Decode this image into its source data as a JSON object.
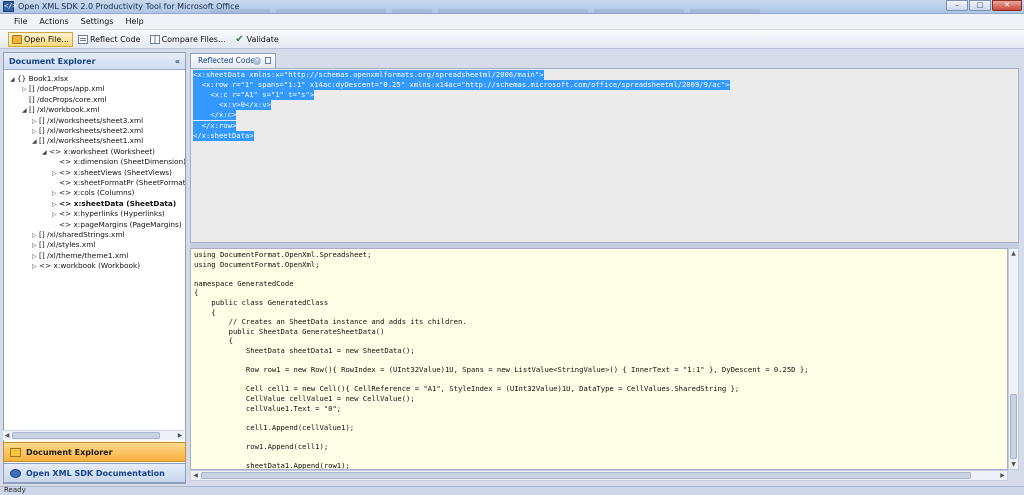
{
  "window": {
    "title": "Open XML SDK 2.0 Productivity Tool for Microsoft Office",
    "app_icon": "</>",
    "controls": {
      "minimize": "–",
      "maximize": "□",
      "close": "✕"
    }
  },
  "menu": [
    "File",
    "Actions",
    "Settings",
    "Help"
  ],
  "toolbar": {
    "open_file": "Open File...",
    "reflect_code": "Reflect Code",
    "compare_files": "Compare Files...",
    "validate": "Validate",
    "icons": {
      "open_file": "folder-icon",
      "reflect_code": "reflect-icon",
      "compare_files": "compare-icon",
      "validate": "check-icon"
    }
  },
  "explorer": {
    "title": "Document Explorer",
    "collapse_glyph": "«",
    "tree": [
      {
        "label": "{} Book1.xlsx",
        "toggle": "◢"
      },
      {
        "label": "[] /docProps/app.xml",
        "toggle": "▷"
      },
      {
        "label": "[] /docProps/core.xml",
        "toggle": ""
      },
      {
        "label": "[] /xl/workbook.xml",
        "toggle": "◢"
      },
      {
        "label": "[] /xl/worksheets/sheet3.xml",
        "toggle": "▷"
      },
      {
        "label": "[] /xl/worksheets/sheet2.xml",
        "toggle": "▷"
      },
      {
        "label": "[] /xl/worksheets/sheet1.xml",
        "toggle": "◢"
      },
      {
        "label": "<> x:worksheet (Worksheet)",
        "toggle": "◢"
      },
      {
        "label": "<> x:dimension (SheetDimension)",
        "toggle": ""
      },
      {
        "label": "<> x:sheetViews (SheetViews)",
        "toggle": "▷"
      },
      {
        "label": "<> x:sheetFormatPr (SheetFormatProperties)",
        "toggle": ""
      },
      {
        "label": "<> x:cols (Columns)",
        "toggle": "▷"
      },
      {
        "label": "<> x:sheetData (SheetData)",
        "toggle": "▷",
        "selected": true
      },
      {
        "label": "<> x:hyperlinks (Hyperlinks)",
        "toggle": "▷"
      },
      {
        "label": "<> x:pageMargins (PageMargins)",
        "toggle": ""
      },
      {
        "label": "[] /xl/sharedStrings.xml",
        "toggle": "▷"
      },
      {
        "label": "[] /xl/styles.xml",
        "toggle": "▷"
      },
      {
        "label": "[] /xl/theme/theme1.xml",
        "toggle": "▷"
      },
      {
        "label": "<> x:workbook (Workbook)",
        "toggle": "▷"
      }
    ],
    "nav": {
      "selected": "Document Explorer",
      "documentation": "Open XML SDK Documentation"
    }
  },
  "tabs": [
    {
      "label": "Reflected Code"
    }
  ],
  "xml": [
    "<x:sheetData xmlns:x=\"http://schemas.openxmlformats.org/spreadsheetml/2006/main\">",
    "  <x:row r=\"1\" spans=\"1:1\" x14ac:dyDescent=\"0.25\" xmlns:x14ac=\"http://schemas.microsoft.com/office/spreadsheetml/2009/9/ac\">",
    "    <x:c r=\"A1\" s=\"1\" t=\"s\">",
    "      <x:v>0</x:v>",
    "    </x:c>",
    "  </x:row>",
    "</x:sheetData>"
  ],
  "code": [
    "using DocumentFormat.OpenXml.Spreadsheet;",
    "using DocumentFormat.OpenXml;",
    "",
    "namespace GeneratedCode",
    "{",
    "    public class GeneratedClass",
    "    {",
    "        // Creates an SheetData instance and adds its children.",
    "        public SheetData GenerateSheetData()",
    "        {",
    "            SheetData sheetData1 = new SheetData();",
    "",
    "            Row row1 = new Row(){ RowIndex = (UInt32Value)1U, Spans = new ListValue<StringValue>() { InnerText = \"1:1\" }, DyDescent = 0.25D };",
    "",
    "            Cell cell1 = new Cell(){ CellReference = \"A1\", StyleIndex = (UInt32Value)1U, DataType = CellValues.SharedString };",
    "            CellValue cellValue1 = new CellValue();",
    "            cellValue1.Text = \"0\";",
    "",
    "            cell1.Append(cellValue1);",
    "",
    "            row1.Append(cell1);",
    "",
    "            sheetData1.Append(row1);"
  ],
  "status": "Ready"
}
